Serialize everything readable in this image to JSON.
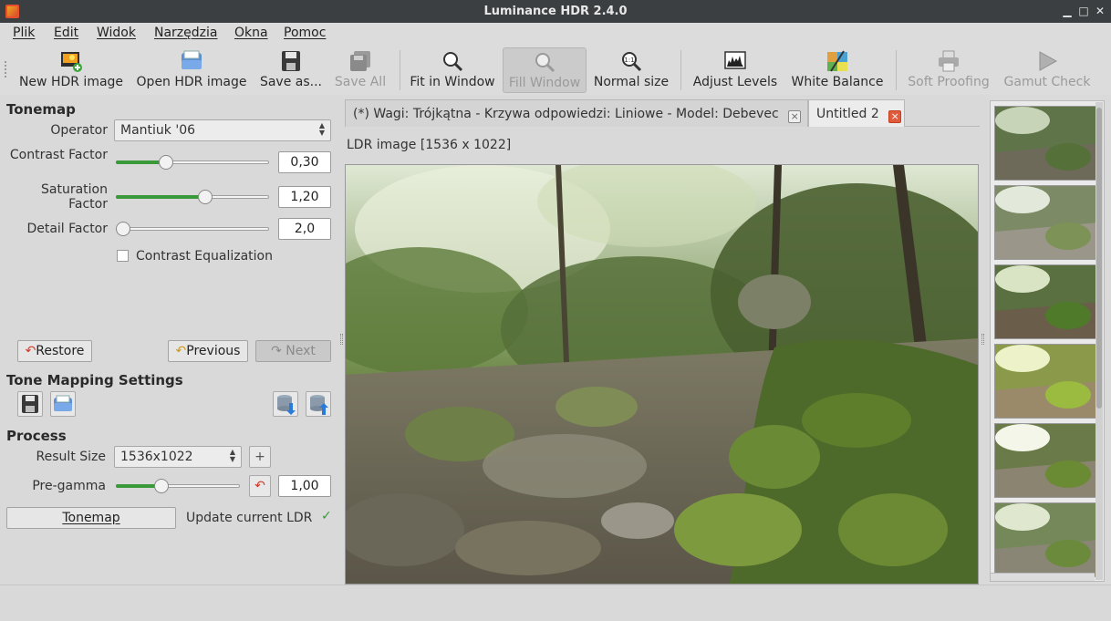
{
  "window": {
    "title": "Luminance HDR 2.4.0"
  },
  "menu": [
    "Plik",
    "Edit",
    "Widok",
    "Narzędzia",
    "Okna",
    "Pomoc"
  ],
  "toolbar": {
    "new_hdr": "New HDR image",
    "open_hdr": "Open HDR image",
    "save_as": "Save as...",
    "save_all": "Save All",
    "fit_window": "Fit in Window",
    "fill_window": "Fill Window",
    "normal_size": "Normal size",
    "adjust_levels": "Adjust Levels",
    "white_balance": "White Balance",
    "soft_proofing": "Soft Proofing",
    "gamut_check": "Gamut Check"
  },
  "tonemap": {
    "title": "Tonemap",
    "operator_label": "Operator",
    "operator_value": "Mantiuk '06",
    "contrast_label": "Contrast Factor",
    "contrast_value": "0,30",
    "contrast_fraction": 0.31,
    "saturation_label": "Saturation Factor",
    "saturation_value": "1,20",
    "saturation_fraction": 0.59,
    "detail_label": "Detail Factor",
    "detail_value": "2,0",
    "detail_fraction": 0.0,
    "contrast_eq_label": "Contrast Equalization",
    "contrast_eq_checked": false,
    "restore": "Restore",
    "previous": "Previous",
    "next": "Next"
  },
  "tms": {
    "title": "Tone Mapping Settings"
  },
  "process": {
    "title": "Process",
    "result_size_label": "Result Size",
    "result_size_value": "1536x1022",
    "pregamma_label": "Pre-gamma",
    "pregamma_value": "1,00",
    "pregamma_fraction": 0.35,
    "tonemap_button": "Tonemap",
    "update_ldr_label": "Update current LDR",
    "update_ldr_checked": true
  },
  "tabs": [
    {
      "label": "(*) Wagi: Trójkątna - Krzywa odpowiedzi: Liniowe - Model: Debevec",
      "active": false
    },
    {
      "label": "Untitled 2",
      "active": true
    }
  ],
  "image_info": "LDR image [1536 x 1022]",
  "thumbnails_count": 6,
  "colors": {
    "accent_green": "#3a9a3a",
    "tab_close_red": "#e05a3c",
    "titlebar": "#3c3f41"
  },
  "icons": {
    "close_tab": "×",
    "tab_close_active": "×",
    "restore": "↶",
    "previous": "↶",
    "next": "↷",
    "plus": "+",
    "reset": "↶",
    "check": "✓",
    "minimize": "▁",
    "maximize": "□",
    "close": "✕"
  }
}
